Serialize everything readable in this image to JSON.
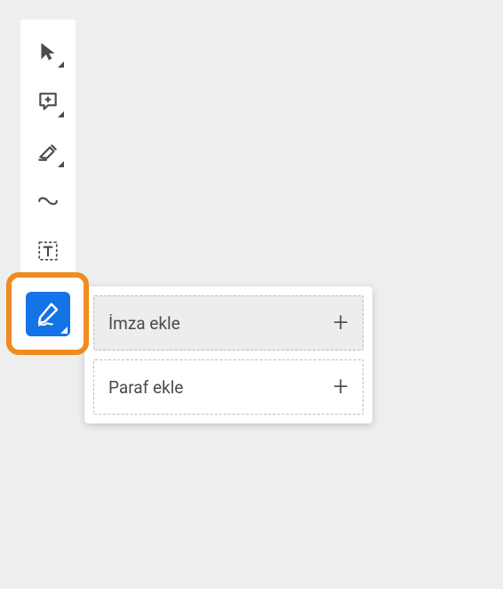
{
  "toolbar": {
    "tools": [
      {
        "name": "select-tool"
      },
      {
        "name": "comment-tool"
      },
      {
        "name": "highlight-tool"
      },
      {
        "name": "draw-tool"
      },
      {
        "name": "text-select-tool"
      },
      {
        "name": "sign-tool"
      }
    ]
  },
  "sign_popover": {
    "options": [
      {
        "label": "İmza ekle",
        "hover": true
      },
      {
        "label": "Paraf ekle",
        "hover": false
      }
    ]
  },
  "icons": {
    "plus": "+"
  }
}
